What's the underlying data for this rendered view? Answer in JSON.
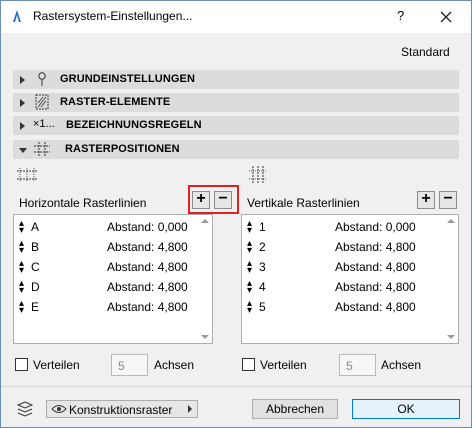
{
  "window": {
    "title": "Rastersystem-Einstellungen...",
    "help": "?",
    "close": "✕"
  },
  "preset": "Standard",
  "sections": [
    {
      "label": "GRUNDEINSTELLUNGEN",
      "icon": "pin-icon",
      "expanded": false
    },
    {
      "label": "RASTER-ELEMENTE",
      "icon": "hatched-box-icon",
      "expanded": false
    },
    {
      "label": "BEZEICHNUNGSREGELN",
      "icon": "x1-label-icon",
      "prefix": "×1...",
      "expanded": false
    },
    {
      "label": "RASTERPOSITIONEN",
      "icon": "grid-positions-icon",
      "expanded": true
    }
  ],
  "horizontal": {
    "label": "Horizontale Rasterlinien",
    "add": "+",
    "remove": "−",
    "rows": [
      {
        "name": "A",
        "distance": "Abstand: 0,000"
      },
      {
        "name": "B",
        "distance": "Abstand: 4,800"
      },
      {
        "name": "C",
        "distance": "Abstand: 4,800"
      },
      {
        "name": "D",
        "distance": "Abstand: 4,800"
      },
      {
        "name": "E",
        "distance": "Abstand: 4,800"
      }
    ],
    "distribute_label": "Verteilen",
    "axes_value": "5",
    "axes_label": "Achsen"
  },
  "vertical": {
    "label": "Vertikale Rasterlinien",
    "add": "+",
    "remove": "−",
    "rows": [
      {
        "name": "1",
        "distance": "Abstand: 0,000"
      },
      {
        "name": "2",
        "distance": "Abstand: 4,800"
      },
      {
        "name": "3",
        "distance": "Abstand: 4,800"
      },
      {
        "name": "4",
        "distance": "Abstand: 4,800"
      },
      {
        "name": "5",
        "distance": "Abstand: 4,800"
      }
    ],
    "distribute_label": "Verteilen",
    "axes_value": "5",
    "axes_label": "Achsen"
  },
  "footer": {
    "layer_value": "Konstruktionsraster",
    "cancel": "Abbrechen",
    "ok": "OK"
  },
  "colors": {
    "highlight": "#e02020",
    "ok_border": "#0078d7"
  }
}
